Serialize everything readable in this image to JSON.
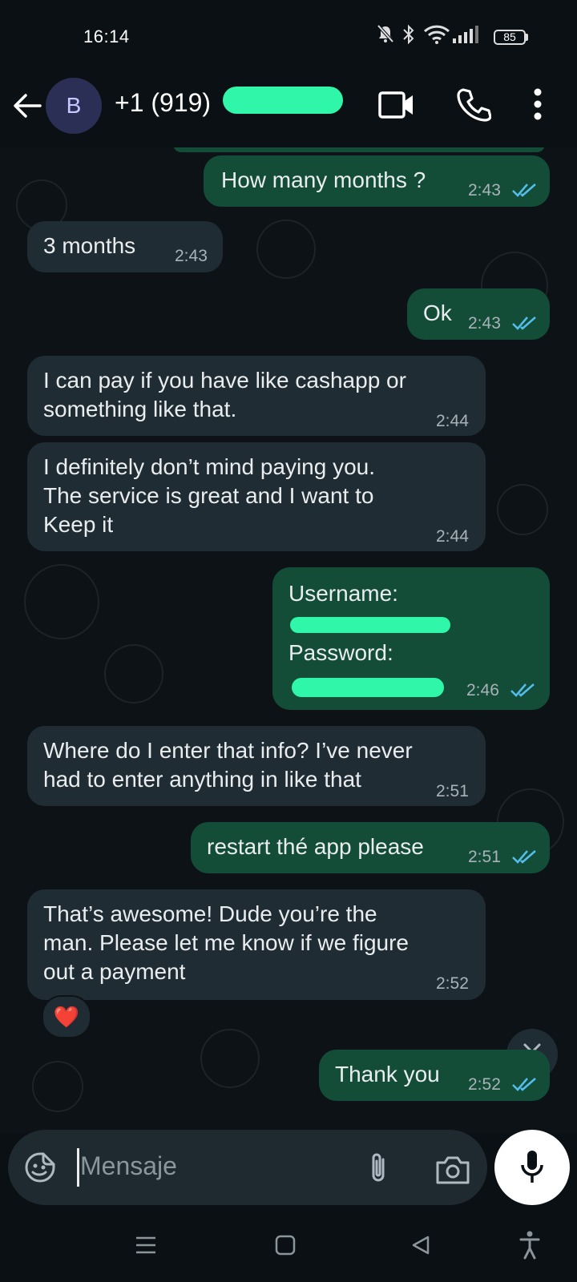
{
  "status_bar": {
    "time": "16:14",
    "battery": "85",
    "icons": [
      "bell-off-icon",
      "bluetooth-icon",
      "wifi-icon",
      "signal-icon",
      "battery-icon"
    ]
  },
  "header": {
    "avatar_initial": "B",
    "contact_name": "+1 (919)",
    "icons": [
      "back-arrow-icon",
      "video-call-icon",
      "phone-icon",
      "more-vert-icon"
    ]
  },
  "messages": [
    {
      "dir": "out",
      "text": [
        "How many months ?"
      ],
      "time": "2:43",
      "status": "read"
    },
    {
      "dir": "in",
      "text": [
        "3 months"
      ],
      "time": "2:43"
    },
    {
      "dir": "out",
      "text": [
        "Ok"
      ],
      "time": "2:43",
      "status": "read"
    },
    {
      "dir": "in",
      "text": [
        "I can pay if you have like cashapp or",
        "something like that."
      ],
      "time": "2:44"
    },
    {
      "dir": "in",
      "text": [
        "I definitely don’t mind paying you.",
        "The service is great and I want to",
        "Keep it"
      ],
      "time": "2:44"
    },
    {
      "dir": "out",
      "text": [
        "Username:",
        "",
        "Password:",
        ""
      ],
      "time": "2:46",
      "status": "read"
    },
    {
      "dir": "in",
      "text": [
        "Where do I enter that info? I’ve never",
        "had to enter anything in like that"
      ],
      "time": "2:51"
    },
    {
      "dir": "out",
      "text": [
        "restart thé app please"
      ],
      "time": "2:51",
      "status": "read"
    },
    {
      "dir": "in",
      "text": [
        "That’s awesome! Dude you’re the",
        "man. Please let me know if we figure",
        "out a payment"
      ],
      "time": "2:52",
      "reaction": "❤️"
    },
    {
      "dir": "out",
      "text": [
        "Thank you"
      ],
      "time": "2:52",
      "status": "read"
    }
  ],
  "input": {
    "placeholder": "Mensaje",
    "icons": [
      "sticker-icon",
      "attach-icon",
      "camera-icon",
      "mic-icon"
    ]
  },
  "scroll_down_icon": "double-chevron-down-icon",
  "navbar_icons": [
    "menu-lines-icon",
    "home-square-icon",
    "back-triangle-icon",
    "accessibility-icon"
  ],
  "colors": {
    "incoming_bubble": "#202c33",
    "outgoing_bubble": "#134d37",
    "read_ticks": "#53bdeb",
    "background": "#0b1014"
  }
}
